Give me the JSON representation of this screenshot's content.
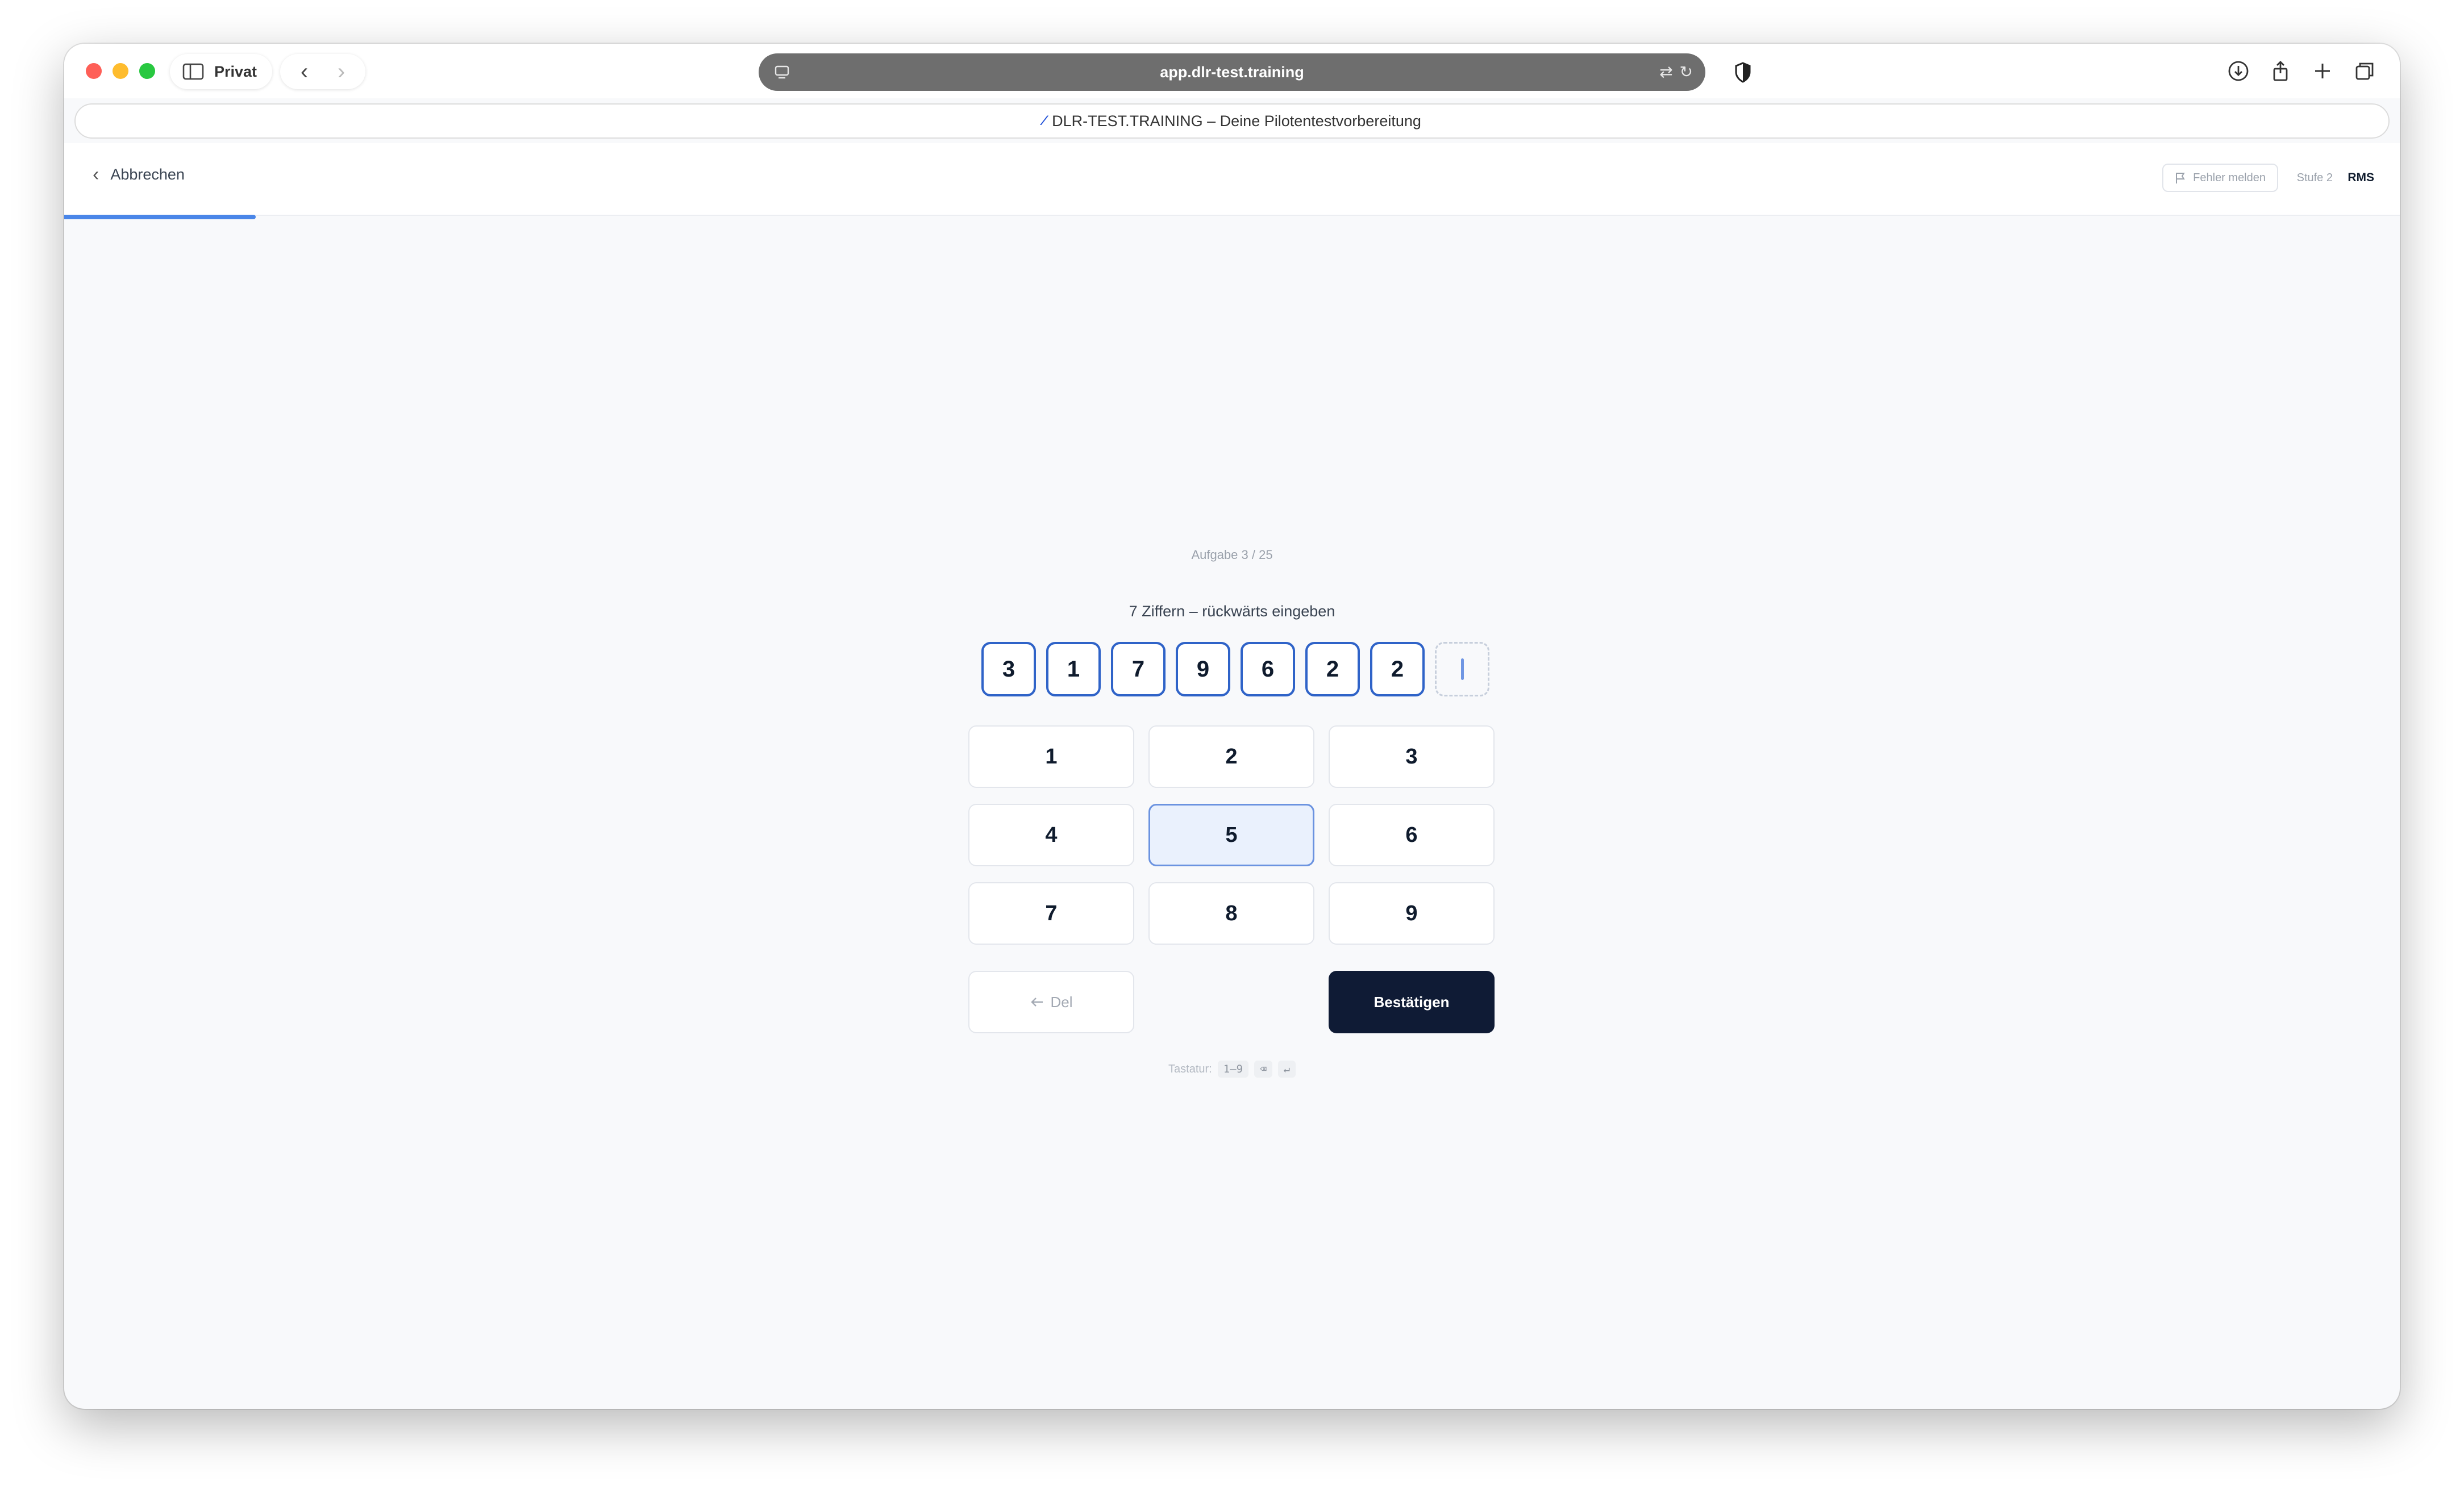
{
  "browser": {
    "profile_label": "Privat",
    "url": "app.dlr-test.training",
    "tab_title": "DLR-TEST.TRAINING – Deine Pilotentestvorbereitung"
  },
  "header": {
    "cancel_label": "Abbrechen",
    "report_label": "Fehler melden",
    "level_label": "Stufe 2",
    "test_code": "RMS"
  },
  "progress": {
    "fraction": 0.082
  },
  "task": {
    "counter": "Aufgabe 3 / 25",
    "instruction": "7 Ziffern – rückwärts eingeben",
    "entered_digits": [
      "3",
      "1",
      "7",
      "9",
      "6",
      "2",
      "2"
    ]
  },
  "keypad": {
    "keys": [
      "1",
      "2",
      "3",
      "4",
      "5",
      "6",
      "7",
      "8",
      "9"
    ],
    "active_key": "5",
    "delete_label": "Del",
    "confirm_label": "Bestätigen"
  },
  "keyboard_hint": {
    "label": "Tastatur:",
    "digits_key": "1–9",
    "delete_key": "⌫",
    "enter_key": "↵"
  },
  "colors": {
    "accent": "#2f63c8",
    "progress": "#4a86e8",
    "confirm_bg": "#0f1b35",
    "active_key_bg": "#eaf1fd"
  }
}
